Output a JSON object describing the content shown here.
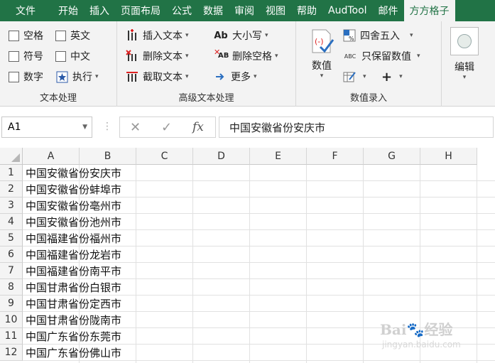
{
  "menu": {
    "tabs": [
      "文件",
      "开始",
      "插入",
      "页面布局",
      "公式",
      "数据",
      "审阅",
      "视图",
      "帮助",
      "AudTool",
      "邮件",
      "方方格子"
    ],
    "active_index": 11
  },
  "ribbon": {
    "text_group": {
      "label": "文本处理",
      "checks": [
        "空格",
        "符号",
        "数字",
        "英文",
        "中文"
      ],
      "execute": "执行"
    },
    "advanced_group": {
      "label": "高级文本处理",
      "insert_text": "插入文本",
      "delete_text": "删除文本",
      "extract_text": "截取文本",
      "case": "大小写",
      "case_icon_text": "Ab",
      "delete_space": "删除空格",
      "delete_space_icon_text": "AB",
      "more": "更多"
    },
    "numeric_group": {
      "label": "数值录入",
      "value": "数值",
      "round": "四舍五入",
      "keep_value": "只保留数值",
      "keep_value_icon_text": "ABC"
    },
    "edit_group": {
      "label": "编辑"
    }
  },
  "formula_bar": {
    "cell_ref": "A1",
    "fx": "fx",
    "content": "中国安徽省份安庆市"
  },
  "grid": {
    "columns": [
      "A",
      "B",
      "C",
      "D",
      "E",
      "F",
      "G",
      "H"
    ],
    "rows": [
      "1",
      "2",
      "3",
      "4",
      "5",
      "6",
      "7",
      "8",
      "9",
      "10",
      "11",
      "12"
    ],
    "values": [
      "中国安徽省份安庆市",
      "中国安徽省份蚌埠市",
      "中国安徽省份亳州市",
      "中国安徽省份池州市",
      "中国福建省份福州市",
      "中国福建省份龙岩市",
      "中国福建省份南平市",
      "中国甘肃省份白银市",
      "中国甘肃省份定西市",
      "中国甘肃省份陇南市",
      "中国广东省份东莞市",
      "中国广东省份佛山市"
    ]
  },
  "watermark": {
    "brand": "Bai",
    "suffix": "经验",
    "url": "jingyan.baidu.com"
  },
  "colors": {
    "excel_green": "#217346",
    "ribbon_bg": "#f3f3f3",
    "grid_line": "#e1e1e1"
  }
}
